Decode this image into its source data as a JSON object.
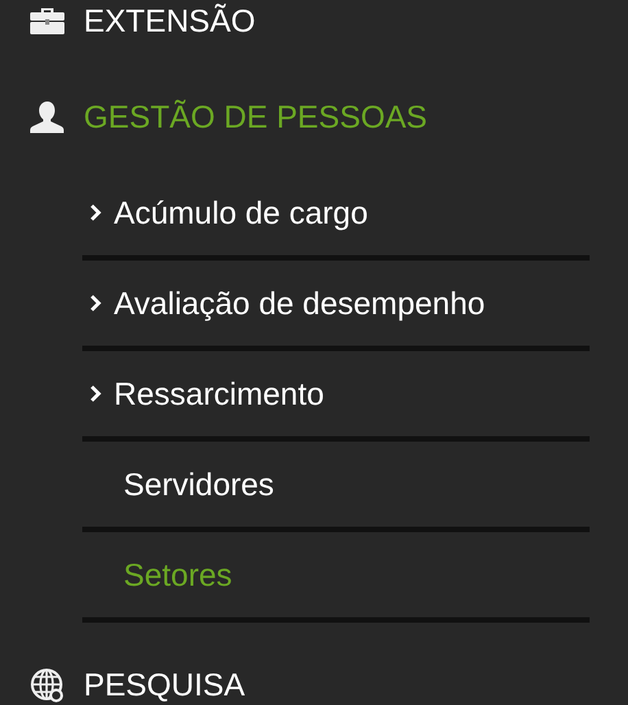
{
  "menu": [
    {
      "label": "EXTENSÃO",
      "selected": false
    },
    {
      "label": "GESTÃO DE PESSOAS",
      "selected": true,
      "children": [
        {
          "label": "Acúmulo de cargo",
          "has_submenu": true,
          "selected": false
        },
        {
          "label": "Avaliação de desempenho",
          "has_submenu": true,
          "selected": false
        },
        {
          "label": "Ressarcimento",
          "has_submenu": true,
          "selected": false
        },
        {
          "label": "Servidores",
          "has_submenu": false,
          "selected": false
        },
        {
          "label": "Setores",
          "has_submenu": false,
          "selected": true
        }
      ]
    },
    {
      "label": "PESQUISA",
      "selected": false
    }
  ]
}
